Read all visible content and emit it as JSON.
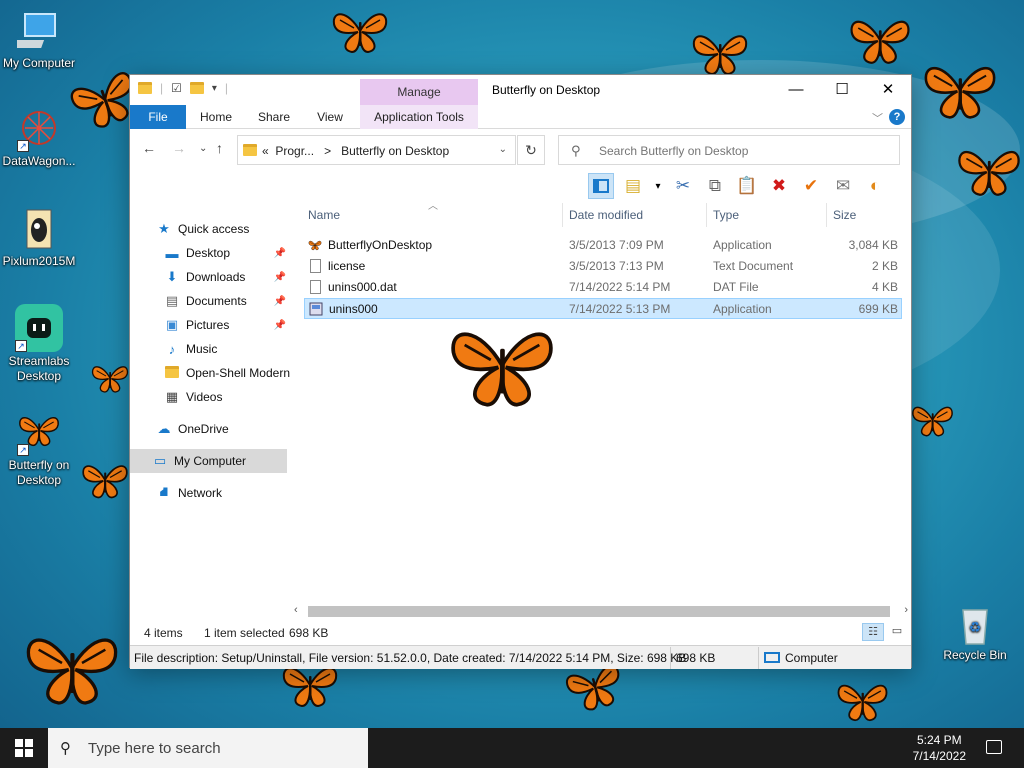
{
  "desktop": {
    "icons": [
      {
        "label": "My Computer"
      },
      {
        "label": "DataWagon..."
      },
      {
        "label": "Pixlum2015M"
      },
      {
        "label": "Streamlabs Desktop"
      },
      {
        "label": "Butterfly on Desktop"
      },
      {
        "label": "Recycle Bin"
      }
    ]
  },
  "window": {
    "title": "Butterfly on Desktop",
    "manage_label": "Manage",
    "ribbon_tabs": [
      "File",
      "Home",
      "Share",
      "View",
      "Application Tools"
    ],
    "help_label": "?",
    "address": {
      "prefix": "«",
      "path1": "Progr...",
      "sep": ">",
      "path2": "Butterfly on Desktop"
    },
    "search_placeholder": "Search Butterfly on Desktop",
    "nav": {
      "items": [
        {
          "label": "Quick access",
          "icon": "star-icon"
        },
        {
          "label": "Desktop",
          "icon": "desktop-icon",
          "pinned": true
        },
        {
          "label": "Downloads",
          "icon": "download-icon",
          "pinned": true
        },
        {
          "label": "Documents",
          "icon": "documents-icon",
          "pinned": true
        },
        {
          "label": "Pictures",
          "icon": "pictures-icon",
          "pinned": true
        },
        {
          "label": "Music",
          "icon": "music-icon"
        },
        {
          "label": "Open-Shell Modern",
          "icon": "folder-icon"
        },
        {
          "label": "Videos",
          "icon": "videos-icon"
        },
        {
          "label": "OneDrive",
          "icon": "cloud-icon"
        },
        {
          "label": "My Computer",
          "icon": "computer-icon",
          "selected": true
        },
        {
          "label": "Network",
          "icon": "network-icon"
        }
      ]
    },
    "columns": [
      "Name",
      "Date modified",
      "Type",
      "Size"
    ],
    "files": [
      {
        "name": "ButterflyOnDesktop",
        "date": "3/5/2013 7:09 PM",
        "type": "Application",
        "size": "3,084 KB",
        "icon": "butterfly-app-icon"
      },
      {
        "name": "license",
        "date": "3/5/2013 7:13 PM",
        "type": "Text Document",
        "size": "2 KB",
        "icon": "text-file-icon"
      },
      {
        "name": "unins000.dat",
        "date": "7/14/2022 5:14 PM",
        "type": "DAT File",
        "size": "4 KB",
        "icon": "dat-file-icon"
      },
      {
        "name": "unins000",
        "date": "7/14/2022 5:13 PM",
        "type": "Application",
        "size": "699 KB",
        "icon": "uninstaller-icon",
        "selected": true
      }
    ],
    "status": {
      "items": "4 items",
      "selected": "1 item selected",
      "size": "698 KB"
    },
    "description": {
      "text": "File description: Setup/Uninstall, File version: 51.52.0.0, Date created: 7/14/2022 5:14 PM, Size: 698 KB",
      "size": "698 KB",
      "location": "Computer"
    }
  },
  "taskbar": {
    "search_placeholder": "Type here to search",
    "time": "5:24 PM",
    "date": "7/14/2022"
  },
  "colors": {
    "accent": "#1979ca",
    "manage": "#e8c8f0",
    "selection": "#cce8ff"
  }
}
